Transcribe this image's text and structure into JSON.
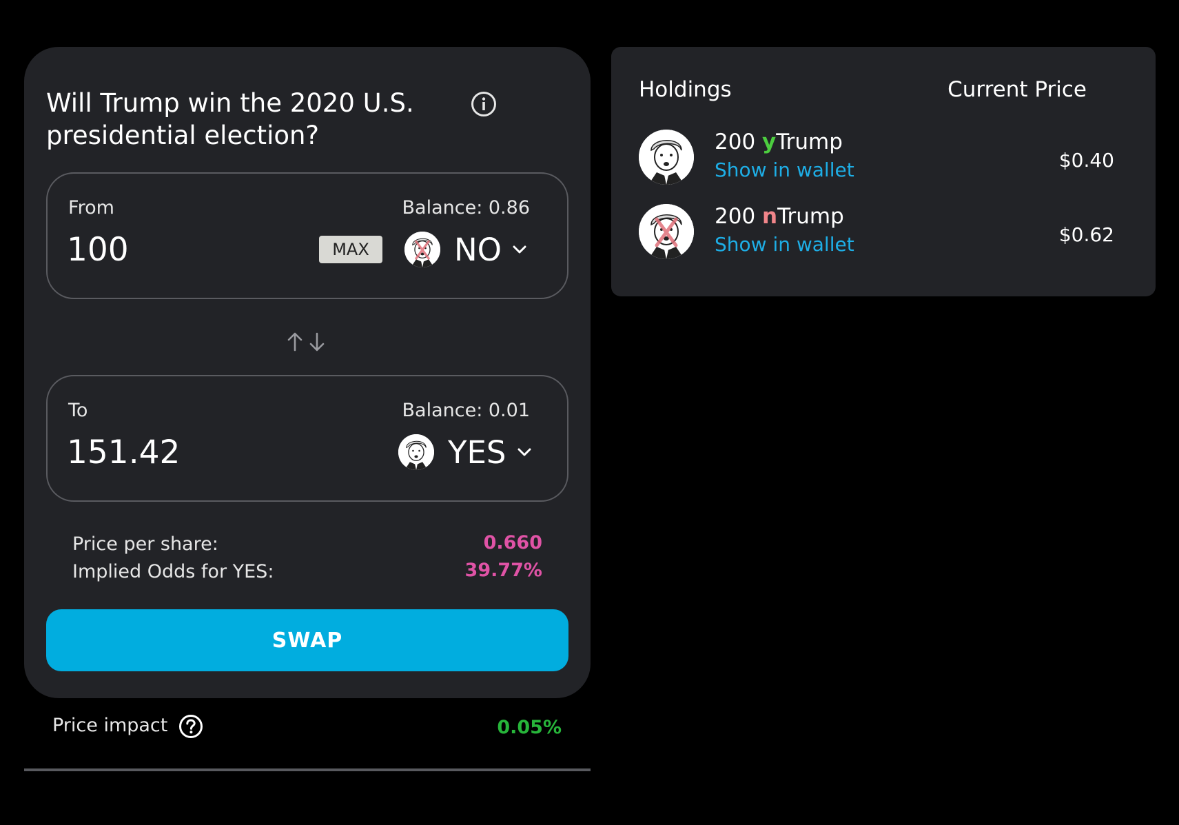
{
  "swap": {
    "question": "Will Trump win the 2020 U.S. presidential election?",
    "from": {
      "label": "From",
      "balance": "Balance: 0.86",
      "amount": "100",
      "max_label": "MAX",
      "token": "NO"
    },
    "to": {
      "label": "To",
      "balance": "Balance: 0.01",
      "amount": "151.42",
      "token": "YES"
    },
    "details": {
      "price_label": "Price per share:",
      "price_value": "0.660",
      "odds_label": "Implied Odds for YES:",
      "odds_value": "39.77%"
    },
    "swap_label": "SWAP"
  },
  "price_impact": {
    "label": "Price impact",
    "value": "0.05%"
  },
  "holdings": {
    "title": "Holdings",
    "price_header": "Current Price",
    "items": [
      {
        "amount": "200",
        "prefix": "y",
        "name": "Trump",
        "link": "Show in wallet",
        "price": "$0.40",
        "icon": "trump-yes-icon"
      },
      {
        "amount": "200",
        "prefix": "n",
        "name": "Trump",
        "link": "Show in wallet",
        "price": "$0.62",
        "icon": "trump-no-icon"
      }
    ]
  },
  "colors": {
    "background": "#000000",
    "card": "#222327",
    "accent": "#01addf",
    "odds": "#e053a6",
    "positive": "#27b53a",
    "yes": "#4ccd3f",
    "no": "#f1858a",
    "link": "#1eaee6"
  }
}
